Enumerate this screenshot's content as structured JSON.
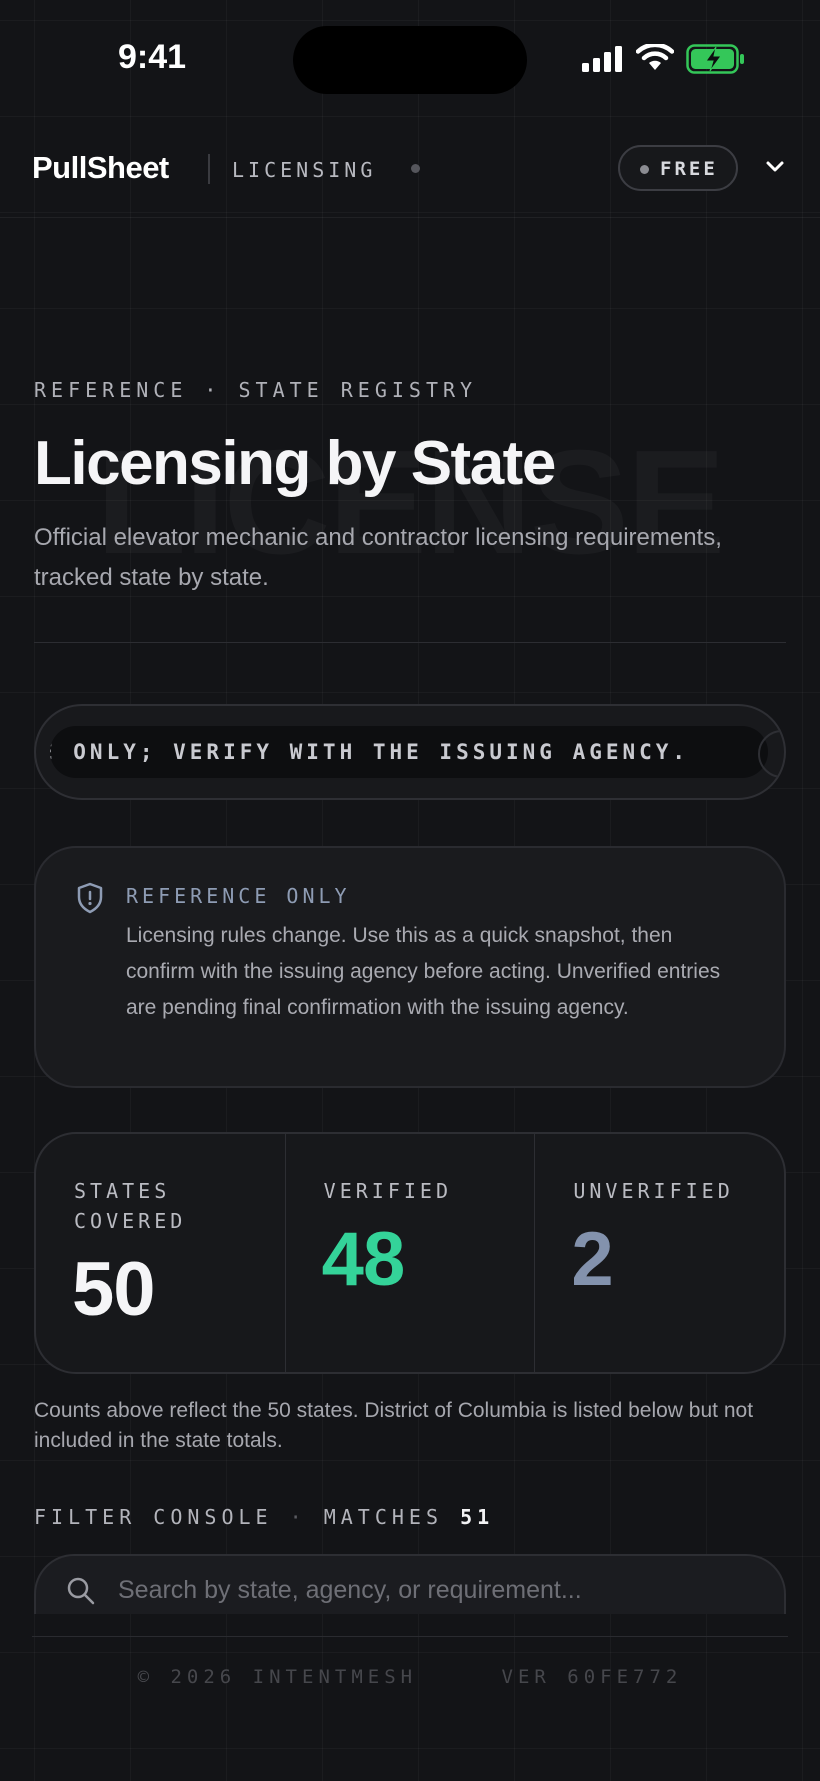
{
  "status_bar": {
    "time": "9:41"
  },
  "header": {
    "logo": "PullSheet",
    "section": "LICENSING",
    "plan_badge": "FREE"
  },
  "hero": {
    "eyebrow": "REFERENCE · STATE REGISTRY",
    "title": "Licensing by State",
    "watermark": "LICENSE",
    "subtitle": "Official elevator mechanic and contractor licensing requirements, tracked state by state."
  },
  "ticker": {
    "text": "E ONLY; VERIFY WITH THE ISSUING AGENCY."
  },
  "notice": {
    "heading": "REFERENCE ONLY",
    "body": "Licensing rules change. Use this as a quick snapshot, then confirm with the issuing agency before acting. Unverified entries are pending final confirmation with the issuing agency."
  },
  "stats": [
    {
      "label": "STATES COVERED",
      "value": "50",
      "color": "#f5f5f7"
    },
    {
      "label": "VERIFIED",
      "value": "48",
      "color": "#34d399"
    },
    {
      "label": "UNVERIFIED",
      "value": "2",
      "color": "#8392ad"
    }
  ],
  "footnote": "Counts above reflect the 50 states. District of Columbia is listed below but not included in the state totals.",
  "filter": {
    "label": "FILTER CONSOLE",
    "separator": "·",
    "matches_label": "MATCHES",
    "matches_count": "51"
  },
  "search": {
    "placeholder": "Search by state, agency, or requirement..."
  },
  "footer": {
    "copyright": "© 2026 INTENTMESH",
    "version": "VER 60FE772"
  }
}
